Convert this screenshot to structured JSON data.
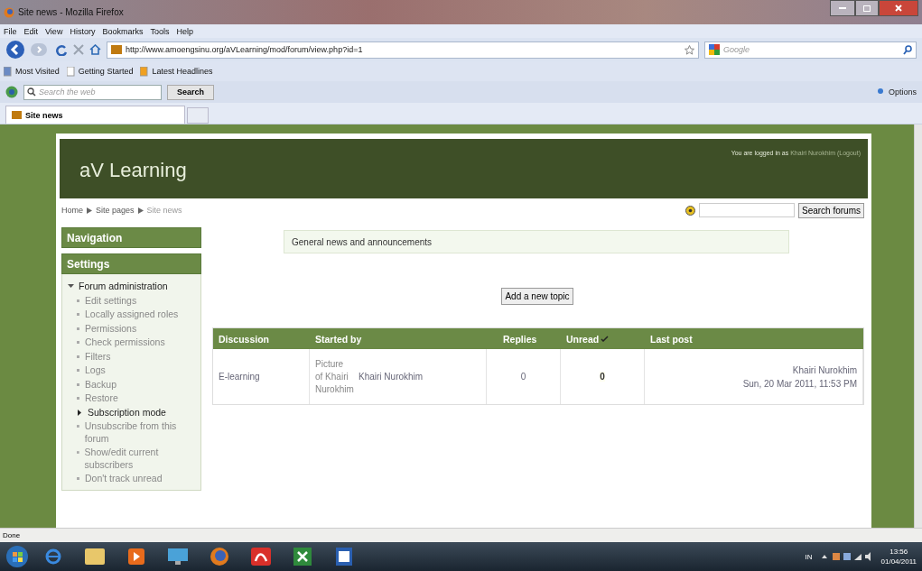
{
  "window": {
    "title": "Site news - Mozilla Firefox"
  },
  "menu": [
    "File",
    "Edit",
    "View",
    "History",
    "Bookmarks",
    "Tools",
    "Help"
  ],
  "address_bar": {
    "url": "http://www.amoengsinu.org/aVLearning/mod/forum/view.php?id=1"
  },
  "web_search": {
    "placeholder": "Google"
  },
  "bookmarks": [
    "Most Visited",
    "Getting Started",
    "Latest Headlines"
  ],
  "search_toolbar": {
    "placeholder": "Search the web",
    "button": "Search",
    "options": "Options"
  },
  "tabs": [
    {
      "label": "Site news",
      "selected": true
    }
  ],
  "page": {
    "site_title": "aV Learning",
    "login": {
      "prefix": "You are logged in as",
      "user": "Khairi Nurokhim",
      "logout": "(Logout)"
    },
    "breadcrumb": [
      "Home",
      "Site pages",
      "Site news"
    ],
    "search_button": "Search forums",
    "blocks": [
      {
        "title": "Navigation"
      },
      {
        "title": "Settings",
        "tree": [
          {
            "kind": "branch",
            "label": "Forum administration",
            "expanded": true,
            "children": [
              {
                "kind": "leaf",
                "label": "Edit settings"
              },
              {
                "kind": "leaf",
                "label": "Locally assigned roles"
              },
              {
                "kind": "leaf",
                "label": "Permissions"
              },
              {
                "kind": "leaf",
                "label": "Check permissions"
              },
              {
                "kind": "leaf",
                "label": "Filters"
              },
              {
                "kind": "leaf",
                "label": "Logs"
              },
              {
                "kind": "leaf",
                "label": "Backup"
              },
              {
                "kind": "leaf",
                "label": "Restore"
              },
              {
                "kind": "branch",
                "label": "Subscription mode",
                "expanded": false
              },
              {
                "kind": "leaf",
                "label": "Unsubscribe from this forum"
              },
              {
                "kind": "leaf",
                "label": "Show/edit current subscribers"
              },
              {
                "kind": "leaf",
                "label": "Don't track unread"
              }
            ]
          }
        ]
      }
    ],
    "intro": "General news and announcements",
    "add_button": "Add a new topic",
    "table": {
      "columns": [
        {
          "label": "Discussion"
        },
        {
          "label": "Started by"
        },
        {
          "label": "Replies"
        },
        {
          "label": "Unread",
          "sorted": true
        },
        {
          "label": "Last post"
        }
      ],
      "rows": [
        {
          "discussion": "E-learning",
          "picture_alt": "Picture of Khairi Nurokhim",
          "author": "Khairi Nurokhim",
          "replies": "0",
          "unread": "0",
          "last_post_author": "Khairi Nurokhim",
          "last_post_date": "Sun, 20 Mar 2011, 11:53 PM"
        }
      ]
    }
  },
  "status_bar": "Done",
  "taskbar": {
    "language": "IN",
    "time": "13:56",
    "date": "01/04/2011"
  }
}
